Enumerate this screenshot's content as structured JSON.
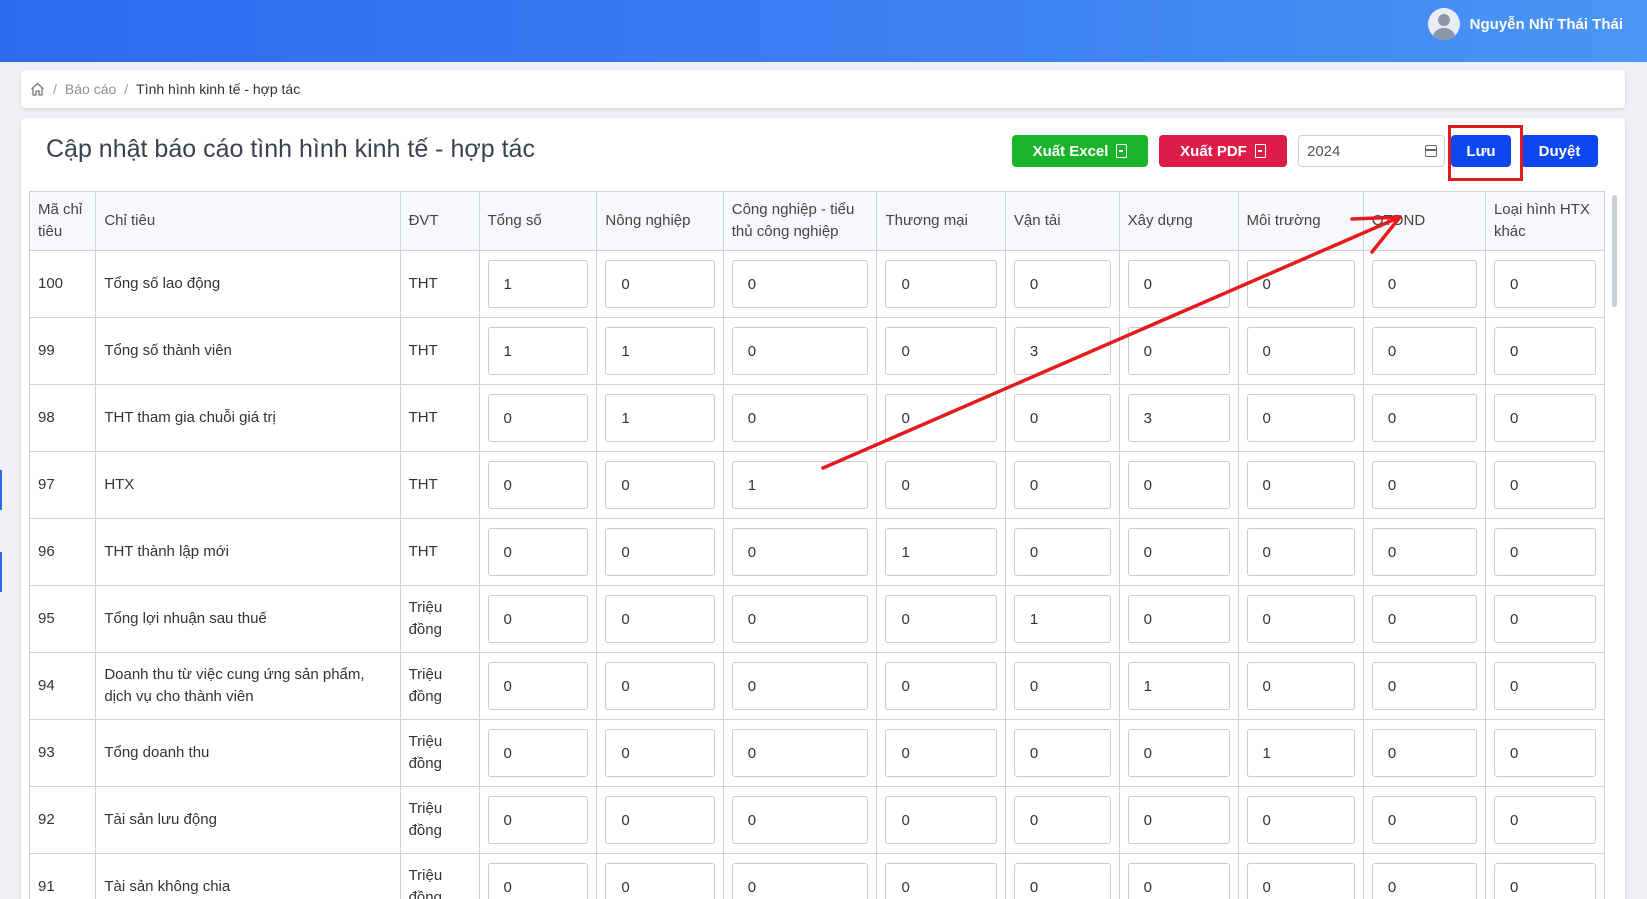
{
  "header": {
    "user_name": "Nguyễn Nhĩ Thái Thái"
  },
  "breadcrumb": {
    "items": [
      "Báo cáo",
      "Tình hình kinh tế - hợp tác"
    ]
  },
  "page": {
    "title": "Cập nhật báo cáo tình hình kinh tế - hợp tác",
    "year_value": "2024"
  },
  "toolbar": {
    "excel_label": "Xuất Excel",
    "pdf_label": "Xuất PDF",
    "save_label": "Lưu",
    "approve_label": "Duyệt"
  },
  "colors": {
    "excel": "#1bb32a",
    "pdf": "#dd1c48",
    "primary": "#0d47f0",
    "annotation": "#e31b1b"
  },
  "table": {
    "columns": [
      "Mã chỉ tiêu",
      "Chỉ tiêu",
      "ĐVT",
      "Tổng số",
      "Nông nghiệp",
      "Công nghiệp - tiểu thủ công nghiệp",
      "Thương mại",
      "Vận tải",
      "Xây dựng",
      "Môi trường",
      "QTDND",
      "Loại hình HTX khác"
    ],
    "rows": [
      {
        "code": "100",
        "name": "Tổng số lao động",
        "unit": "THT",
        "values": [
          "1",
          "0",
          "0",
          "0",
          "0",
          "0",
          "0",
          "0",
          "0"
        ]
      },
      {
        "code": "99",
        "name": "Tổng số thành viên",
        "unit": "THT",
        "values": [
          "1",
          "1",
          "0",
          "0",
          "3",
          "0",
          "0",
          "0",
          "0"
        ]
      },
      {
        "code": "98",
        "name": "THT tham gia chuỗi giá trị",
        "unit": "THT",
        "values": [
          "0",
          "1",
          "0",
          "0",
          "0",
          "3",
          "0",
          "0",
          "0"
        ]
      },
      {
        "code": "97",
        "name": "HTX",
        "unit": "THT",
        "values": [
          "0",
          "0",
          "1",
          "0",
          "0",
          "0",
          "0",
          "0",
          "0"
        ]
      },
      {
        "code": "96",
        "name": "THT thành lập mới",
        "unit": "THT",
        "values": [
          "0",
          "0",
          "0",
          "1",
          "0",
          "0",
          "0",
          "0",
          "0"
        ]
      },
      {
        "code": "95",
        "name": "Tổng lợi nhuận sau thuế",
        "unit": "Triệu đồng",
        "values": [
          "0",
          "0",
          "0",
          "0",
          "1",
          "0",
          "0",
          "0",
          "0"
        ]
      },
      {
        "code": "94",
        "name": "Doanh thu từ việc cung ứng sản phẩm, dịch vụ cho thành viên",
        "unit": "Triệu đồng",
        "values": [
          "0",
          "0",
          "0",
          "0",
          "0",
          "1",
          "0",
          "0",
          "0"
        ]
      },
      {
        "code": "93",
        "name": "Tổng doanh thu",
        "unit": "Triệu đồng",
        "values": [
          "0",
          "0",
          "0",
          "0",
          "0",
          "0",
          "1",
          "0",
          "0"
        ]
      },
      {
        "code": "92",
        "name": "Tài sản lưu động",
        "unit": "Triệu đồng",
        "values": [
          "0",
          "0",
          "0",
          "0",
          "0",
          "0",
          "0",
          "0",
          "0"
        ]
      },
      {
        "code": "91",
        "name": "Tài sản không chia",
        "unit": "Triệu đồng",
        "values": [
          "0",
          "0",
          "0",
          "0",
          "0",
          "0",
          "0",
          "0",
          "0"
        ]
      }
    ]
  }
}
